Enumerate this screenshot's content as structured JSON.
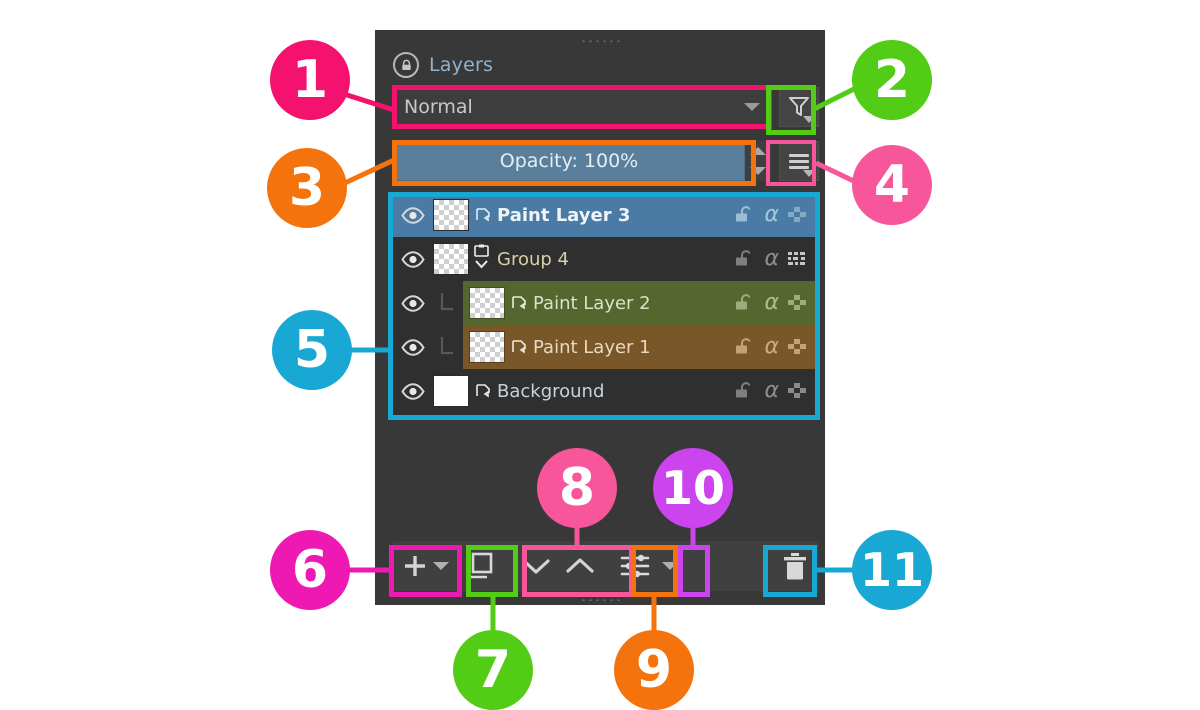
{
  "panel": {
    "title": "Layers",
    "lock_icon": "lock-icon",
    "grip_icon": "drag-grip-icon"
  },
  "blend_mode": {
    "value": "Normal",
    "dropdown_icon": "chevron-down-icon"
  },
  "filter_button": {
    "icon": "filter-funnel-icon",
    "dropdown_icon": "chevron-down-icon"
  },
  "opacity": {
    "label": "Opacity:  100%",
    "value": 100,
    "fill_color": "#5a7f9c",
    "spinner_up_icon": "spinner-up-icon",
    "spinner_down_icon": "spinner-down-icon"
  },
  "menu_button": {
    "icon": "hamburger-menu-icon",
    "dropdown_icon": "chevron-down-icon"
  },
  "layers": [
    {
      "name": "Paint Layer 3",
      "type": "paint",
      "selected": true,
      "indent": 0,
      "row_color": "#4a7ba4",
      "visible_icon": "eye-icon",
      "thumbnail": "transparent-checker",
      "type_icon": "paint-layer-icon",
      "lock_icon": "unlocked-padlock-icon",
      "alpha_icon": "alpha-lock-icon",
      "alpha_symbol": "α",
      "inherit_icon": "checkerboard-icon"
    },
    {
      "name": "Group 4",
      "type": "group",
      "selected": false,
      "indent": 0,
      "row_color": "#2f2f2f",
      "visible_icon": "eye-icon",
      "thumbnail": "transparent-checker",
      "type_icon": "group-folder-icon",
      "collapse_icon": "chevron-down-icon",
      "lock_icon": "unlocked-padlock-icon",
      "alpha_icon": "alpha-lock-icon",
      "alpha_symbol": "α",
      "inherit_icon": "pass-through-icon"
    },
    {
      "name": "Paint Layer 2",
      "type": "paint",
      "selected": false,
      "indent": 1,
      "row_color": "#56662f",
      "visible_icon": "eye-icon",
      "thumbnail": "transparent-checker",
      "type_icon": "paint-layer-icon",
      "tree_icon": "tree-branch-icon",
      "lock_icon": "unlocked-padlock-icon",
      "alpha_icon": "alpha-lock-icon",
      "alpha_symbol": "α",
      "inherit_icon": "checkerboard-icon"
    },
    {
      "name": "Paint Layer 1",
      "type": "paint",
      "selected": false,
      "indent": 1,
      "row_color": "#7a5728",
      "visible_icon": "eye-icon",
      "thumbnail": "transparent-checker",
      "type_icon": "paint-layer-icon",
      "tree_icon": "tree-branch-icon",
      "lock_icon": "unlocked-padlock-icon",
      "alpha_icon": "alpha-lock-icon",
      "alpha_symbol": "α",
      "inherit_icon": "checkerboard-icon"
    },
    {
      "name": "Background",
      "type": "paint",
      "selected": false,
      "indent": 0,
      "row_color": "#2f2f2f",
      "visible_icon": "eye-icon",
      "thumbnail": "white-fill",
      "type_icon": "paint-layer-icon",
      "lock_icon": "unlocked-padlock-icon",
      "alpha_icon": "alpha-lock-icon",
      "alpha_symbol": "α",
      "inherit_icon": "checkerboard-icon"
    }
  ],
  "toolbar": {
    "add_layer_icon": "plus-icon",
    "add_layer_dropdown_icon": "chevron-down-icon",
    "duplicate_layer_icon": "duplicate-layer-icon",
    "move_down_icon": "chevron-down-icon",
    "move_up_icon": "chevron-up-icon",
    "properties_icon": "sliders-properties-icon",
    "properties_dropdown_icon": "chevron-down-icon",
    "delete_layer_icon": "trash-icon"
  },
  "annotations": [
    {
      "n": "1",
      "color": "#f5116e",
      "target": "blend-mode-combo"
    },
    {
      "n": "2",
      "color": "#52cc14",
      "target": "filter-button"
    },
    {
      "n": "3",
      "color": "#f4730c",
      "target": "opacity-slider"
    },
    {
      "n": "4",
      "color": "#f7569b",
      "target": "menu-button"
    },
    {
      "n": "5",
      "color": "#19a8d4",
      "target": "layer-list"
    },
    {
      "n": "6",
      "color": "#ee19b2",
      "target": "add-layer-button"
    },
    {
      "n": "7",
      "color": "#52cc14",
      "target": "duplicate-layer-button"
    },
    {
      "n": "8",
      "color": "#f7569b",
      "target": "move-layer-buttons"
    },
    {
      "n": "9",
      "color": "#f4730c",
      "target": "layer-properties-button"
    },
    {
      "n": "10",
      "color": "#cc44ee",
      "target": "properties-dropdown-button"
    },
    {
      "n": "11",
      "color": "#19a8d4",
      "target": "delete-layer-button"
    }
  ]
}
